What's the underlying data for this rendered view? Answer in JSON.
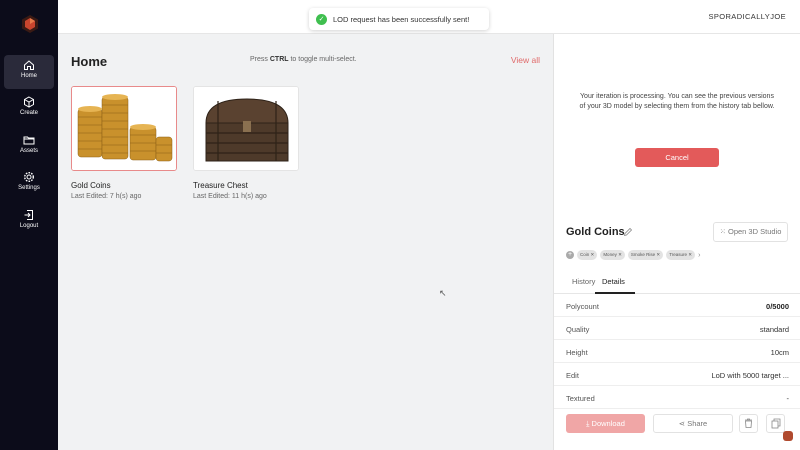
{
  "app": {
    "accent": "#e35a5a",
    "sidebar_bg": "#0c0c1a"
  },
  "user": {
    "name": "SPORADICALLYJOE"
  },
  "toast": {
    "message": "LOD request has been successfully sent!",
    "icon": "check-circle-icon"
  },
  "sidebar": {
    "items": [
      {
        "label": "Home",
        "icon": "home-icon",
        "active": true
      },
      {
        "label": "Create",
        "icon": "cube-icon"
      },
      {
        "label": "Assets",
        "icon": "folder-icon"
      },
      {
        "label": "Settings",
        "icon": "gear-icon"
      },
      {
        "label": "Logout",
        "icon": "logout-icon"
      }
    ]
  },
  "main": {
    "title": "Home",
    "hint_prefix": "Press",
    "hint_key": "CTRL",
    "hint_suffix": "to toggle multi-select.",
    "view_all": "View all",
    "cards": [
      {
        "name": "Gold Coins",
        "meta": "Last Edited: 7 h(s) ago",
        "selected": true
      },
      {
        "name": "Treasure Chest",
        "meta": "Last Edited: 11 h(s) ago"
      }
    ]
  },
  "panel": {
    "processing_text": "Your iteration is processing. You can see the previous versions of your 3D model by selecting them from the history tab bellow.",
    "cancel_label": "Cancel",
    "asset_title": "Gold Coins",
    "open_studio_label": "Open 3D Studio",
    "tags": [
      "Coin",
      "Money",
      "Smoke Rise",
      "Treasure"
    ],
    "tabs": [
      "History",
      "Details"
    ],
    "active_tab": "Details",
    "details": [
      {
        "key": "Polycount",
        "value": "0/5000"
      },
      {
        "key": "Quality",
        "value": "standard"
      },
      {
        "key": "Height",
        "value": "10cm"
      },
      {
        "key": "Edit",
        "value": "LoD with 5000 target ..."
      },
      {
        "key": "Textured",
        "value": "-"
      }
    ],
    "download_label": "Download",
    "share_label": "Share"
  }
}
